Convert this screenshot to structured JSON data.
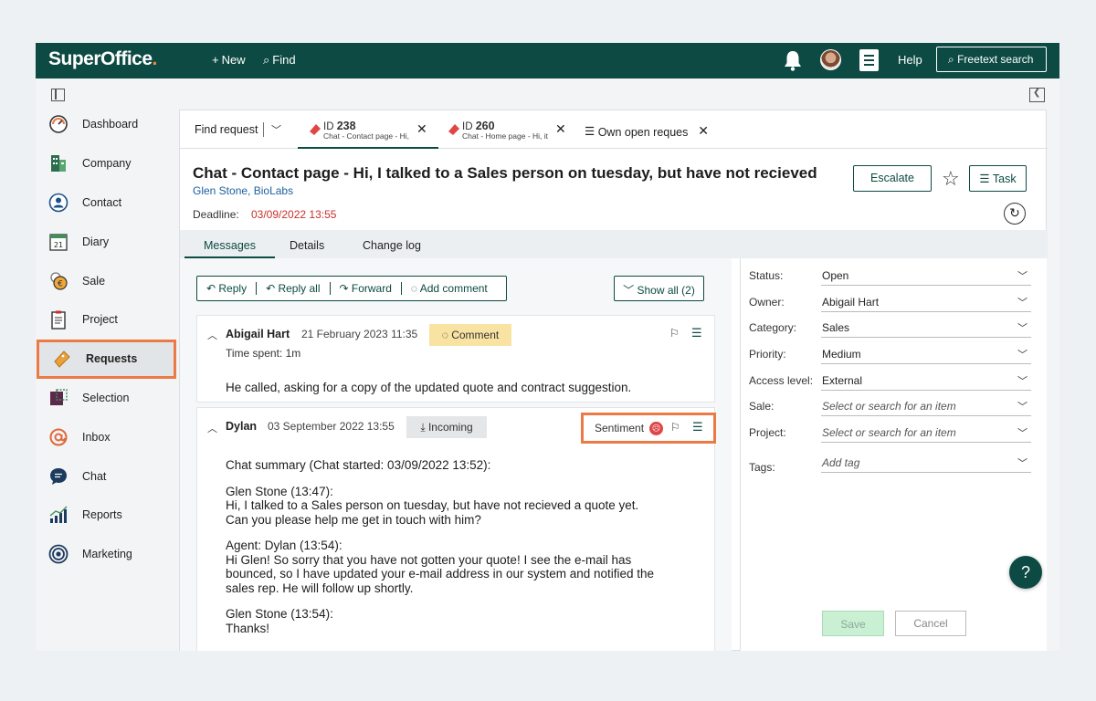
{
  "app": {
    "brand": "SuperOffice",
    "brand_dot": "."
  },
  "topbar": {
    "new_label": "New",
    "find_label": "Find",
    "help_label": "Help",
    "freetext_label": "Freetext search"
  },
  "nav": {
    "items": [
      {
        "label": "Dashboard",
        "icon": "gauge-icon"
      },
      {
        "label": "Company",
        "icon": "building-icon"
      },
      {
        "label": "Contact",
        "icon": "person-icon"
      },
      {
        "label": "Diary",
        "icon": "calendar-icon",
        "day": "21"
      },
      {
        "label": "Sale",
        "icon": "coins-icon"
      },
      {
        "label": "Project",
        "icon": "clipboard-icon"
      },
      {
        "label": "Requests",
        "icon": "ticket-icon",
        "active": true
      },
      {
        "label": "Selection",
        "icon": "selection-icon"
      },
      {
        "label": "Inbox",
        "icon": "at-sign-icon"
      },
      {
        "label": "Chat",
        "icon": "chat-bubble-icon"
      },
      {
        "label": "Reports",
        "icon": "bar-chart-icon"
      },
      {
        "label": "Marketing",
        "icon": "target-icon"
      }
    ]
  },
  "tabs": {
    "find_request": "Find request",
    "request_tabs": [
      {
        "id_label": "ID",
        "id": "238",
        "subtitle": "Chat - Contact page - Hi,",
        "active": true
      },
      {
        "id_label": "ID",
        "id": "260",
        "subtitle": "Chat - Home page - Hi, it",
        "active": false
      }
    ],
    "own_open": "Own open request:"
  },
  "request": {
    "title": "Chat - Contact page - Hi, I talked to a Sales person on tuesday, but have not recieved",
    "contact": "Glen Stone",
    "company": "BioLabs",
    "deadline_label": "Deadline:",
    "deadline_value": "03/09/2022 13:55",
    "escalate_label": "Escalate",
    "task_label": "Task"
  },
  "subtabs": {
    "messages": "Messages",
    "details": "Details",
    "changelog": "Change log"
  },
  "actions": {
    "reply": "Reply",
    "reply_all": "Reply all",
    "forward": "Forward",
    "add_comment": "Add comment",
    "show_all": "Show all (2)"
  },
  "messages": [
    {
      "author": "Abigail Hart",
      "date": "21 February 2023 11:35",
      "badge": "Comment",
      "time_spent": "Time spent:  1m",
      "body": "He called, asking for a copy of the updated quote and contract suggestion."
    },
    {
      "author": "Dylan",
      "date": "03 September 2022 13:55",
      "badge": "Incoming",
      "sentiment_label": "Sentiment",
      "body": [
        "Chat summary (Chat started: 03/09/2022 13:52):",
        "Glen Stone (13:47):",
        "Hi, I talked to a Sales person on tuesday, but have not recieved a quote yet.",
        "Can you please help me get in touch with him?",
        "Agent: Dylan (13:54):",
        "Hi Glen! So sorry that you have not gotten your quote! I see the e-mail has",
        "bounced, so I have updated your e-mail address in our system and notified the",
        "sales rep. He will follow up shortly.",
        "Glen Stone (13:54):",
        "Thanks!"
      ]
    }
  ],
  "fields": [
    {
      "label": "Status:",
      "value": "Open",
      "placeholder": false
    },
    {
      "label": "Owner:",
      "value": "Abigail Hart",
      "placeholder": false
    },
    {
      "label": "Category:",
      "value": "Sales",
      "placeholder": false
    },
    {
      "label": "Priority:",
      "value": "Medium",
      "placeholder": false
    },
    {
      "label": "Access level:",
      "value": "External",
      "placeholder": false
    },
    {
      "label": "Sale:",
      "value": "Select or search for an item",
      "placeholder": true
    },
    {
      "label": "Project:",
      "value": "Select or search for an item",
      "placeholder": true
    },
    {
      "label": "Tags:",
      "value": "Add tag",
      "placeholder": true
    }
  ],
  "buttons": {
    "save": "Save",
    "cancel": "Cancel",
    "help_fab": "?"
  },
  "colors": {
    "brand": "#0d4a43",
    "highlight": "#ec7a45",
    "deadline": "#c8302c",
    "comment_badge": "#f9e3a3"
  }
}
